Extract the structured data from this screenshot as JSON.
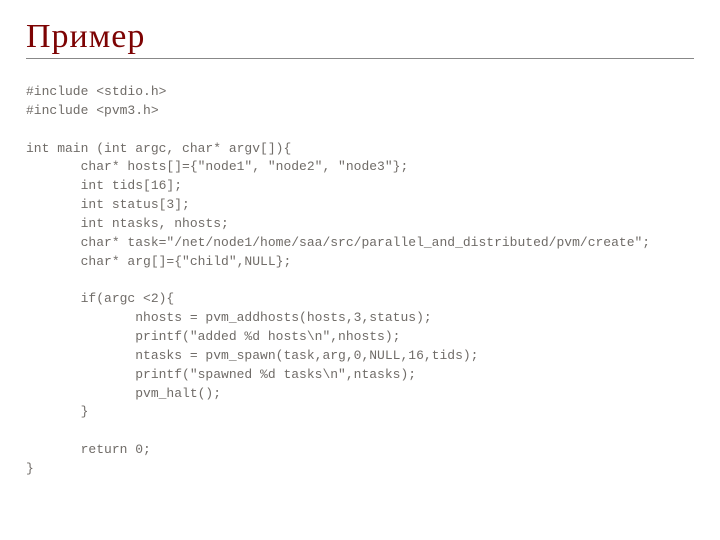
{
  "title": "Пример",
  "code_lines": [
    "#include <stdio.h>",
    "#include <pvm3.h>",
    "",
    "int main (int argc, char* argv[]){",
    "       char* hosts[]={\"node1\", \"node2\", \"node3\"};",
    "       int tids[16];",
    "       int status[3];",
    "       int ntasks, nhosts;",
    "       char* task=\"/net/node1/home/saa/src/parallel_and_distributed/pvm/create\";",
    "       char* arg[]={\"child\",NULL};",
    "",
    "       if(argc <2){",
    "              nhosts = pvm_addhosts(hosts,3,status);",
    "              printf(\"added %d hosts\\n\",nhosts);",
    "              ntasks = pvm_spawn(task,arg,0,NULL,16,tids);",
    "              printf(\"spawned %d tasks\\n\",ntasks);",
    "              pvm_halt();",
    "       }",
    "",
    "       return 0;",
    "}"
  ]
}
